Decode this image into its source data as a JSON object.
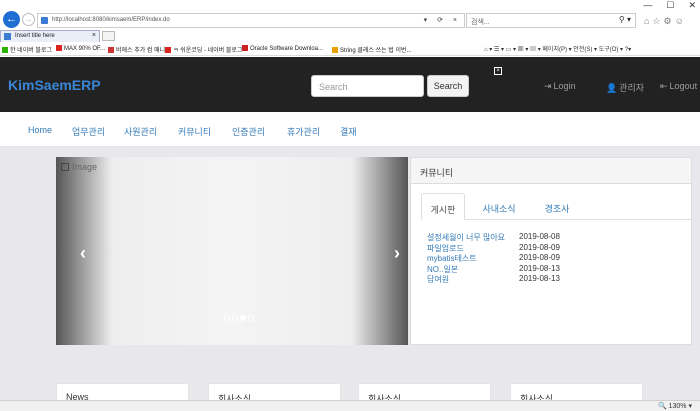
{
  "browser": {
    "window_controls": [
      "—",
      "☐",
      "✕"
    ],
    "address": "http://localhost:8080/kimsaem/ERP/index.do",
    "search_placeholder": "검색...",
    "tab_title": "Insert title here",
    "favorites": [
      {
        "label": "한 네이버 블로그",
        "color": "#2db400"
      },
      {
        "label": "MAX 90% OF...",
        "color": "#d22"
      },
      {
        "label": "비에스 추가 컴 매니",
        "color": "#c33"
      },
      {
        "label": "ㅋ 쉬운코딩 - 네이버 블로그",
        "color": "#d22"
      },
      {
        "label": "Oracle Software Downloa...",
        "color": "#c22"
      },
      {
        "label": "String 클래스 쓰는 법 이번...",
        "color": "#e8a000"
      }
    ],
    "command_bar": "⌂ ▾  ☰ ▾  ▭ ▾  ▦ ▾  ▤ ▾  페이지(P) ▾  안전(S) ▾  도구(O) ▾  ?▾",
    "zoom": "🔍 130%  ▾"
  },
  "site": {
    "brand": "KimSaemERP",
    "search_placeholder": "Search",
    "search_button": "Search",
    "login": "Login",
    "admin": "관리자",
    "logout": "Logout"
  },
  "menu": [
    "Home",
    "업무관리",
    "사원관리",
    "커뮤니티",
    "인증관리",
    "휴가관리",
    "결재"
  ],
  "carousel": {
    "image_label": "Image",
    "prev": "‹",
    "next": "›"
  },
  "community": {
    "heading": "커뮤니티",
    "tabs": [
      "게시판",
      "사내소식",
      "경조사"
    ],
    "posts": [
      {
        "title": "설정세월이 너무 많아요",
        "date": "2019-08-08"
      },
      {
        "title": "파일업로드",
        "date": "2019-08-09"
      },
      {
        "title": "mybatis테스트",
        "date": "2019-08-09"
      },
      {
        "title": "NO..일본",
        "date": "2019-08-13"
      },
      {
        "title": "답여원",
        "date": "2019-08-13"
      }
    ]
  },
  "bottom_boxes": [
    "News",
    "회사소식",
    "회사소식",
    "회사소식"
  ]
}
